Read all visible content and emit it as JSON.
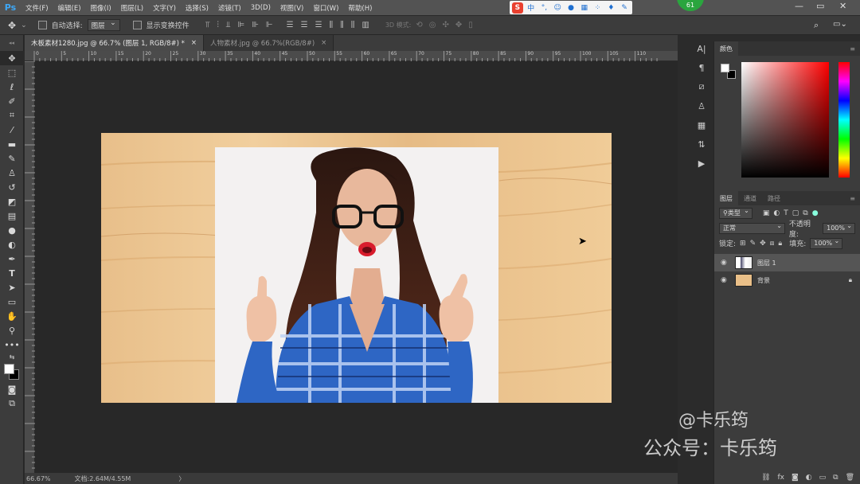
{
  "menubar": {
    "logo": "Ps",
    "items": [
      "文件(F)",
      "编辑(E)",
      "图像(I)",
      "图层(L)",
      "文字(Y)",
      "选择(S)",
      "滤镜(T)",
      "3D(D)",
      "视图(V)",
      "窗口(W)",
      "帮助(H)"
    ],
    "ime_lang": "中",
    "badge": "61",
    "win_minimize": "—",
    "win_restore": "▭",
    "win_close": "✕"
  },
  "options": {
    "auto_select_label": "自动选择:",
    "auto_select_value": "图层",
    "show_transform_label": "显示变换控件",
    "mode3d_label": "3D 模式:"
  },
  "tabs": [
    {
      "label": "木板素材1280.jpg @ 66.7% (图层 1, RGB/8#) *",
      "close": "×"
    },
    {
      "label": "人物素材.jpg @ 66.7%(RGB/8#)",
      "close": "×"
    }
  ],
  "ruler_top_ticks": [
    "0",
    "5",
    "10",
    "15",
    "20",
    "25",
    "30",
    "35",
    "40",
    "45",
    "50",
    "55",
    "60",
    "65",
    "70",
    "75",
    "80",
    "85",
    "90",
    "95",
    "100",
    "105",
    "110"
  ],
  "status": {
    "zoom": "66.67%",
    "doc": "文档:2.64M/4.55M",
    "arrow": "〉"
  },
  "colors_panel": {
    "tab": "颜色"
  },
  "layers_panel": {
    "tabs": [
      "图层",
      "通道",
      "路径"
    ],
    "filter_kind": "类型",
    "blend_mode": "正常",
    "opacity_label": "不透明度:",
    "opacity_value": "100%",
    "lock_label": "锁定:",
    "fill_label": "填充:",
    "fill_value": "100%",
    "layers": [
      {
        "name": "图层 1",
        "selected": true
      },
      {
        "name": "背景",
        "selected": false,
        "locked": true
      }
    ]
  },
  "watermark": {
    "line1": "@卡乐筠",
    "line2": "公众号：卡乐筠"
  }
}
